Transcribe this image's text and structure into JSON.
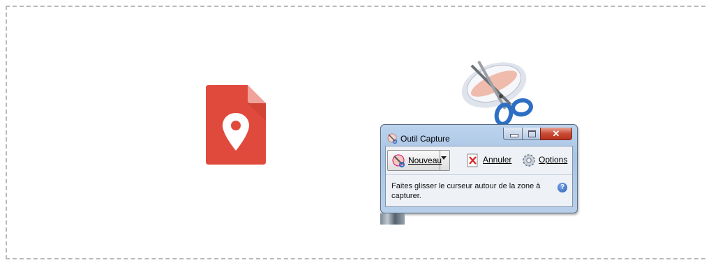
{
  "snipping_tool": {
    "title": "Outil Capture",
    "toolbar": {
      "new_label": "Nouveau",
      "cancel_label": "Annuler",
      "options_label": "Options"
    },
    "hint_text": "Faites glisser le curseur autour de la zone à capturer."
  },
  "icons": {
    "maps_doc": "google-my-maps-document-icon",
    "snip_app": "snipping-tool-app-icon",
    "help": "help-icon"
  },
  "colors": {
    "maps_red": "#e04a3c",
    "title_blue": "#a9c5e6",
    "close_red": "#c94c34",
    "frame_border": "#b9b9b9"
  }
}
